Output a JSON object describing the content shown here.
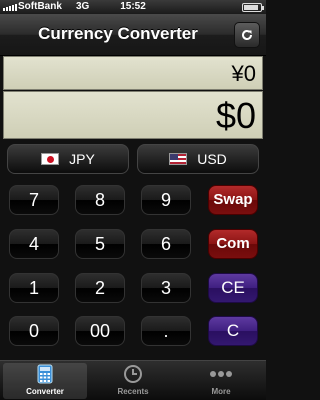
{
  "status": {
    "carrier": "SoftBank",
    "network": "3G",
    "time": "15:52"
  },
  "nav": {
    "title": "Currency Converter"
  },
  "display": {
    "source_value": "¥0",
    "target_value": "$0"
  },
  "currency": {
    "from_code": "JPY",
    "to_code": "USD"
  },
  "keys": {
    "k7": "7",
    "k8": "8",
    "k9": "9",
    "swap": "Swap",
    "k4": "4",
    "k5": "5",
    "k6": "6",
    "com": "Com",
    "k1": "1",
    "k2": "2",
    "k3": "3",
    "ce": "CE",
    "k0": "0",
    "k00": "00",
    "dot": ".",
    "clear": "C"
  },
  "tabs": {
    "converter": "Converter",
    "recents": "Recents",
    "more": "More"
  },
  "colors": {
    "display_bg": "#d8d8c2",
    "red_key": "#8a1414",
    "purple_key": "#3f1f80"
  }
}
